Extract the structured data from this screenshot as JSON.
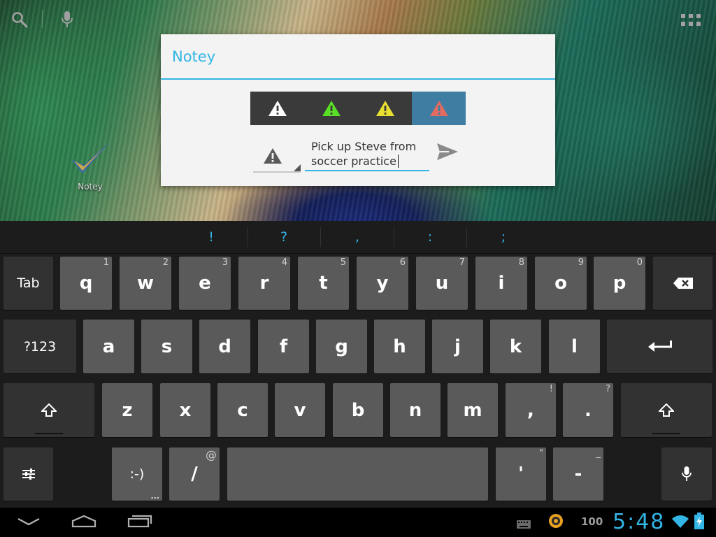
{
  "launcher": {
    "app_label": "Notey"
  },
  "dialog": {
    "title": "Notey",
    "priority_buttons": [
      {
        "name": "priority-white",
        "color": "#ffffff",
        "selected": false
      },
      {
        "name": "priority-green",
        "color": "#59e026",
        "selected": false
      },
      {
        "name": "priority-yellow",
        "color": "#e8e030",
        "selected": false
      },
      {
        "name": "priority-red",
        "color": "#e26a60",
        "selected": true
      }
    ],
    "note_text": "Pick up Steve from\nsoccer practice",
    "spinner_icon": "warning-icon",
    "send_icon": "send-icon",
    "accent": "#33b5e5"
  },
  "keyboard": {
    "suggestions": [
      "!",
      "?",
      ",",
      ":",
      ";"
    ],
    "row1": {
      "tab": "Tab",
      "keys": [
        {
          "label": "q",
          "hint": "1"
        },
        {
          "label": "w",
          "hint": "2"
        },
        {
          "label": "e",
          "hint": "3"
        },
        {
          "label": "r",
          "hint": "4"
        },
        {
          "label": "t",
          "hint": "5"
        },
        {
          "label": "y",
          "hint": "6"
        },
        {
          "label": "u",
          "hint": "7"
        },
        {
          "label": "i",
          "hint": "8"
        },
        {
          "label": "o",
          "hint": "9"
        },
        {
          "label": "p",
          "hint": "0"
        }
      ]
    },
    "row2": {
      "symbols": "?123",
      "keys": [
        "a",
        "s",
        "d",
        "f",
        "g",
        "h",
        "j",
        "k",
        "l"
      ]
    },
    "row3": {
      "keys": [
        {
          "label": "z",
          "hint": ""
        },
        {
          "label": "x",
          "hint": ""
        },
        {
          "label": "c",
          "hint": ""
        },
        {
          "label": "v",
          "hint": ""
        },
        {
          "label": "b",
          "hint": ""
        },
        {
          "label": "n",
          "hint": ""
        },
        {
          "label": "m",
          "hint": ""
        },
        {
          "label": ",",
          "hint": "!"
        },
        {
          "label": ".",
          "hint": "?"
        }
      ]
    },
    "row4": {
      "smiley": ":-)",
      "smiley_more": "...",
      "slash": "/",
      "slash_hint": "@",
      "apostrophe": "'",
      "apostrophe_hint": "\"",
      "dash": "-",
      "dash_hint": "_"
    }
  },
  "statusbar": {
    "battery_level": "100",
    "clock": "5:48"
  }
}
